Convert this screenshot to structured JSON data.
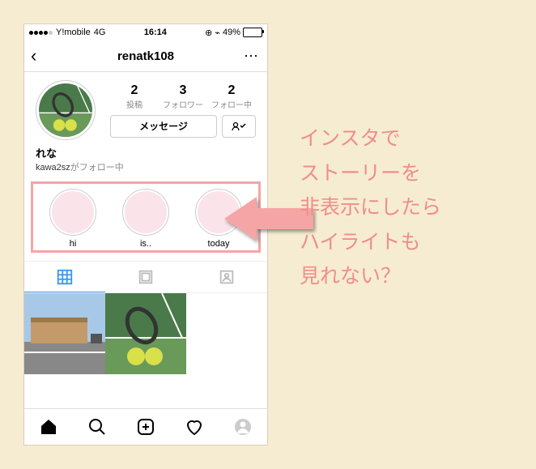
{
  "status": {
    "carrier": "Y!mobile",
    "network": "4G",
    "time": "16:14",
    "battery_pct": "49%"
  },
  "nav": {
    "title": "renatk108",
    "back_glyph": "‹",
    "menu_glyph": "⋯"
  },
  "profile": {
    "stats": {
      "posts": {
        "count": "2",
        "label": "投稿"
      },
      "followers": {
        "count": "3",
        "label": "フォロワー"
      },
      "following": {
        "count": "2",
        "label": "フォロー中"
      }
    },
    "message_btn": "メッセージ",
    "display_name": "れな",
    "followed_by_prefix": "kawa2sz",
    "followed_by_suffix": "がフォロー中"
  },
  "highlights": [
    {
      "label": "hi"
    },
    {
      "label": "is.."
    },
    {
      "label": "today"
    }
  ],
  "caption": {
    "l1": "インスタで",
    "l2": "ストーリーを",
    "l3": "非表示にしたら",
    "l4": "ハイライトも",
    "l5": "見れない？"
  }
}
